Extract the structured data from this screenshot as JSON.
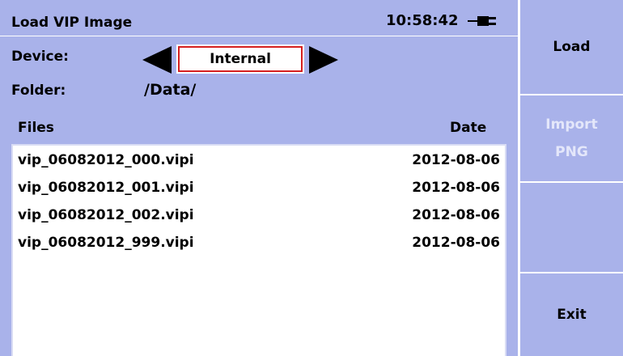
{
  "title_bar": {
    "title": "Load VIP Image",
    "time": "10:58:42",
    "power_icon": "plug-icon"
  },
  "device": {
    "label": "Device:",
    "value": "Internal",
    "prev_icon": "triangle-left-icon",
    "next_icon": "triangle-right-icon"
  },
  "folder": {
    "label": "Folder:",
    "value": "/Data/"
  },
  "file_list": {
    "columns": [
      "Files",
      "Date"
    ],
    "rows": [
      {
        "name": "vip_06082012_000.vipi",
        "date": "2012-08-06"
      },
      {
        "name": "vip_06082012_001.vipi",
        "date": "2012-08-06"
      },
      {
        "name": "vip_06082012_002.vipi",
        "date": "2012-08-06"
      },
      {
        "name": "vip_06082012_999.vipi",
        "date": "2012-08-06"
      }
    ]
  },
  "side_buttons": {
    "load": "Load",
    "import_line1": "Import",
    "import_line2": "PNG",
    "exit": "Exit"
  },
  "colors": {
    "panel": "#a9b2ea",
    "device_border": "#d62020",
    "disabled_text": "#e4e7fa"
  }
}
